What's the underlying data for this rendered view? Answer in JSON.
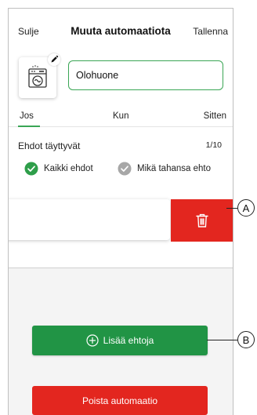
{
  "header": {
    "close_label": "Sulje",
    "title": "Muuta automaatiota",
    "save_label": "Tallenna"
  },
  "automation": {
    "icon": "dishwasher-icon",
    "edit_icon": "pencil-icon",
    "name_value": "Olohuone"
  },
  "tabs": [
    {
      "label": "Jos",
      "active": true
    },
    {
      "label": "Kun",
      "active": false
    },
    {
      "label": "Sitten",
      "active": false
    }
  ],
  "conditions": {
    "label": "Ehdot täyttyvät",
    "count": "1/10",
    "options": [
      {
        "label": "Kaikki ehdot",
        "selected": true
      },
      {
        "label": "Mikä tahansa ehto",
        "selected": false
      }
    ]
  },
  "condition_row": {
    "delete_icon": "trash-icon"
  },
  "actions": {
    "add_conditions_label": "Lisää ehtoja",
    "add_icon": "plus-circle-icon",
    "delete_automation_label": "Poista automaatio"
  },
  "callouts": [
    "A",
    "B"
  ],
  "colors": {
    "accent_green": "#219445",
    "input_border_green": "#3aa655",
    "danger_red": "#e3261f",
    "selected_radio": "#2e9e4a",
    "unselected_radio": "#a7a7a7"
  }
}
